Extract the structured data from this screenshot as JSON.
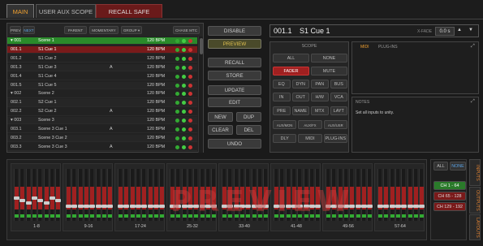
{
  "tabs": {
    "main": "MAIN",
    "aux": "USER AUX SCOPE",
    "recall": "RECALL SAFE"
  },
  "cue_toolbar": {
    "prev": "PREV",
    "next": "NEXT",
    "parent": "PARENT",
    "momentary": "MOMENTARY",
    "group": "GROUP ▾",
    "chase": "CHASE MTC"
  },
  "cues": [
    {
      "num": "▾ 001",
      "name": "Scene 1",
      "flag": "",
      "bpm": "120 BPM"
    },
    {
      "num": "001.1",
      "name": "S1 Cue 1",
      "flag": "",
      "bpm": "120 BPM"
    },
    {
      "num": "001.2",
      "name": "S1 Cue 2",
      "flag": "",
      "bpm": "120 BPM"
    },
    {
      "num": "001.3",
      "name": "S1 Cue 3",
      "flag": "A",
      "bpm": "120 BPM"
    },
    {
      "num": "001.4",
      "name": "S1 Cue 4",
      "flag": "",
      "bpm": "120 BPM"
    },
    {
      "num": "001.5",
      "name": "S1 Cue 5",
      "flag": "",
      "bpm": "120 BPM"
    },
    {
      "num": "▾ 002",
      "name": "Scene 2",
      "flag": "",
      "bpm": "120 BPM"
    },
    {
      "num": "002.1",
      "name": "S2 Cue 1",
      "flag": "",
      "bpm": "120 BPM"
    },
    {
      "num": "002.2",
      "name": "S2 Cue 2",
      "flag": "A",
      "bpm": "120 BPM"
    },
    {
      "num": "▾ 003",
      "name": "Scene 3",
      "flag": "",
      "bpm": "120 BPM"
    },
    {
      "num": "003.1",
      "name": "Scene 3 Cue 1",
      "flag": "A",
      "bpm": "120 BPM"
    },
    {
      "num": "003.2",
      "name": "Scene 3 Cue 2",
      "flag": "",
      "bpm": "120 BPM"
    },
    {
      "num": "003.3",
      "name": "Scene 3 Cue 3",
      "flag": "A",
      "bpm": "120 BPM"
    }
  ],
  "commands": {
    "disable": "DISABLE",
    "preview": "PREVIEW",
    "recall": "RECALL",
    "store": "STORE",
    "update": "UPDATE",
    "edit": "EDIT",
    "new": "NEW",
    "dup": "DUP",
    "clear": "CLEAR",
    "del": "DEL",
    "undo": "UNDO"
  },
  "cue_header": {
    "number": "001.1",
    "name": "S1 Cue 1",
    "xfade_label": "X-FADE",
    "xfade_value": "0.0 s"
  },
  "scope": {
    "title": "SCOPE",
    "buttons": [
      [
        "ALL",
        "NONE"
      ],
      [
        "FADER",
        "MUTE"
      ],
      [
        "EQ",
        "DYN",
        "PAN",
        "BUS"
      ],
      [
        "IN",
        "OUT",
        "H/W",
        "VCA"
      ],
      [
        "PRE",
        "NAME",
        "MTX",
        "LAYT"
      ],
      [
        "AUX/MON",
        "AUX/FX",
        "AUX/USR"
      ],
      [
        "DLY",
        "MIDI",
        "PLUG-INS"
      ]
    ]
  },
  "midi_tabs": {
    "midi": "MIDI",
    "plugins": "PLUG-INS"
  },
  "notes": {
    "title": "NOTES",
    "text": "Set all inputs to unity."
  },
  "banks": [
    "1-8",
    "9-16",
    "17-24",
    "25-32",
    "33-40",
    "41-48",
    "49-56",
    "57-64"
  ],
  "watermark": "PREVIEW",
  "right_controls": {
    "all": "ALL",
    "none": "NONE",
    "ranges": [
      "CH 1 - 64",
      "CH 65 - 128",
      "CH 129 - 192"
    ]
  },
  "side_tabs": [
    "INPUTS",
    "OUTPUTS",
    "LAYOUTS"
  ],
  "colors": {
    "selected_green": "#2a8a2a",
    "recall_red": "#7a1a1a",
    "accent_orange": "#f0a030"
  }
}
